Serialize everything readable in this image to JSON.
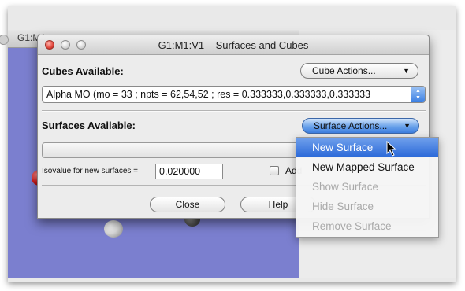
{
  "background_window": {
    "title": "G1:M1"
  },
  "dialog": {
    "title": "G1:M1:V1 – Surfaces and Cubes",
    "cubes_label": "Cubes Available:",
    "cube_actions_label": "Cube Actions...",
    "cube_selected": "Alpha MO (mo = 33 ; npts = 62,54,52 ; res = 0.333333,0.333333,0.333333",
    "surfaces_label": "Surfaces Available:",
    "surface_actions_label": "Surface Actions...",
    "isovalue_label": "Isovalue for new surfaces =",
    "isovalue_value": "0.020000",
    "checkbox_label": "Add",
    "close_label": "Close",
    "help_label": "Help"
  },
  "surface_actions_menu": {
    "items": [
      {
        "label": "New Surface",
        "state": "highlighted"
      },
      {
        "label": "New Mapped Surface",
        "state": "enabled"
      },
      {
        "label": "Show Surface",
        "state": "disabled"
      },
      {
        "label": "Hide Surface",
        "state": "disabled"
      },
      {
        "label": "Remove Surface",
        "state": "disabled"
      }
    ]
  },
  "colors": {
    "viewport_background": "#7b7fcf",
    "menu_highlight": "#2a68d8",
    "close_button_red": "#e0443a"
  },
  "icons": {
    "popup_caret": "chevron-down-icon",
    "stepper": "up-down-arrows-icon",
    "cursor": "arrow-cursor-icon"
  }
}
